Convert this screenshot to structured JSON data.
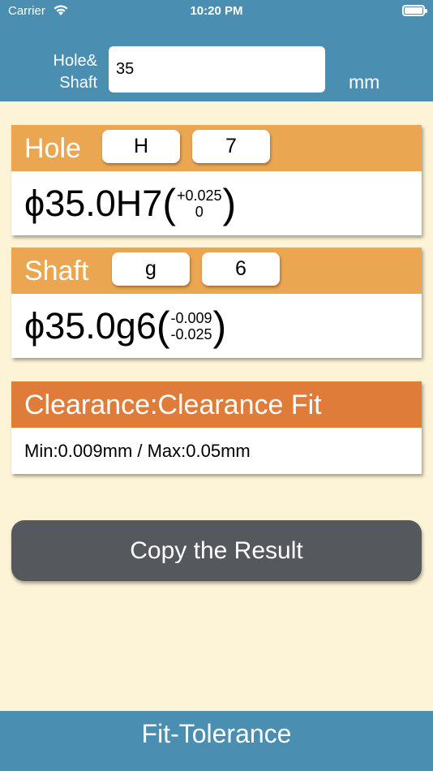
{
  "status": {
    "carrier": "Carrier",
    "time": "10:20 PM"
  },
  "header": {
    "input_label_line1": "Hole&",
    "input_label_line2": "Shaft",
    "size_value": "35",
    "unit": "mm"
  },
  "hole": {
    "title": "Hole",
    "letter": "H",
    "grade": "7",
    "designation": "ϕ35.0H7",
    "paren_open": "(",
    "upper_dev": "+0.025",
    "lower_dev": "0",
    "paren_close": ")"
  },
  "shaft": {
    "title": "Shaft",
    "letter": "g",
    "grade": "6",
    "designation": "ϕ35.0g6",
    "paren_open": "(",
    "upper_dev": "-0.009",
    "lower_dev": "-0.025",
    "paren_close": ")"
  },
  "result": {
    "title": "Clearance:Clearance Fit",
    "detail": "Min:0.009mm / Max:0.05mm"
  },
  "copy_button": {
    "label": "Copy the Result"
  },
  "footer": {
    "title": "Fit-Tolerance"
  },
  "colors": {
    "top_bar": "#4a8fb1",
    "background": "#fdf4d8",
    "card_header": "#eba652",
    "result_header": "#e07c3a",
    "copy_button": "#55585d"
  },
  "icons": [
    "wifi-icon",
    "battery-icon"
  ]
}
